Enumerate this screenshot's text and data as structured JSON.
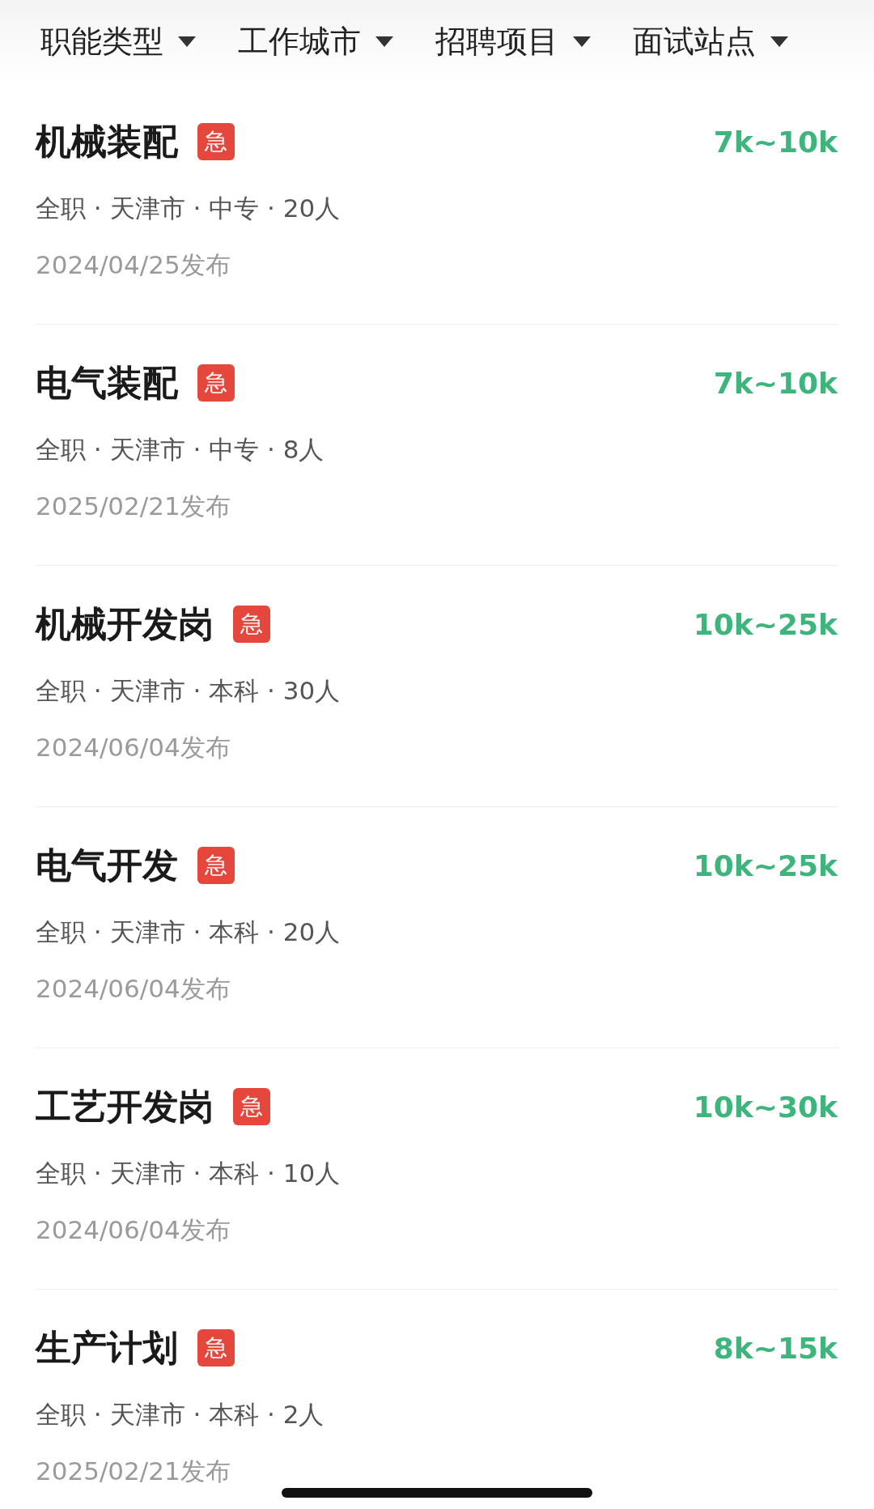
{
  "filters": [
    {
      "label": "职能类型"
    },
    {
      "label": "工作城市"
    },
    {
      "label": "招聘项目"
    },
    {
      "label": "面试站点"
    }
  ],
  "jobs": [
    {
      "title": "机械装配",
      "badge": "急",
      "salary": "7k~10k",
      "meta": "全职 · 天津市 · 中专 · 20人",
      "date": "2024/04/25发布"
    },
    {
      "title": "电气装配",
      "badge": "急",
      "salary": "7k~10k",
      "meta": "全职 · 天津市 · 中专 · 8人",
      "date": "2025/02/21发布"
    },
    {
      "title": "机械开发岗",
      "badge": "急",
      "salary": "10k~25k",
      "meta": "全职 · 天津市 · 本科 · 30人",
      "date": "2024/06/04发布"
    },
    {
      "title": "电气开发",
      "badge": "急",
      "salary": "10k~25k",
      "meta": "全职 · 天津市 · 本科 · 20人",
      "date": "2024/06/04发布"
    },
    {
      "title": "工艺开发岗",
      "badge": "急",
      "salary": "10k~30k",
      "meta": "全职 · 天津市 · 本科 · 10人",
      "date": "2024/06/04发布"
    },
    {
      "title": "生产计划",
      "badge": "急",
      "salary": "8k~15k",
      "meta": "全职 · 天津市 · 本科 · 2人",
      "date": "2025/02/21发布"
    }
  ]
}
